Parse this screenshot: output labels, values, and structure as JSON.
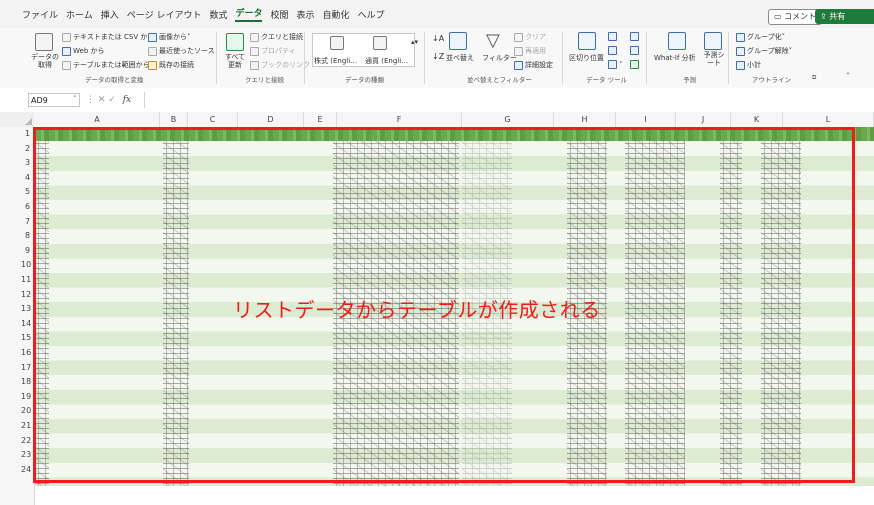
{
  "menu": {
    "tabs": [
      "ファイル",
      "ホーム",
      "挿入",
      "ページ レイアウト",
      "数式",
      "データ",
      "校閲",
      "表示",
      "自動化",
      "ヘルプ"
    ],
    "active_tab": "データ",
    "comment_label": "コメント",
    "share_label": "共有"
  },
  "ribbon": {
    "get_data": {
      "get_data_label": "データの取得",
      "from_text_csv": "テキストまたは CSV から",
      "from_web": "Web から",
      "from_table_range": "テーブルまたは範囲から",
      "from_picture": "画像から",
      "recent_sources": "最近使ったソース",
      "existing_connections": "既存の接続",
      "group_label": "データの取得と変換"
    },
    "queries": {
      "refresh_all": "すべて更新",
      "queries_connections": "クエリと接続",
      "properties": "プロパティ",
      "edit_links": "ブックのリンク",
      "group_label": "クエリと接続"
    },
    "data_types": {
      "stocks": "株式 (Engli…",
      "currencies": "通貨 (Engli…",
      "group_label": "データの種類"
    },
    "sort_filter": {
      "sort": "並べ替え",
      "filter": "フィルター",
      "clear": "クリア",
      "reapply": "再適用",
      "advanced": "詳細設定",
      "group_label": "並べ替えとフィルター"
    },
    "data_tools": {
      "text_to_columns": "区切り位置",
      "group_label": "データ ツール"
    },
    "forecast": {
      "what_if": "What-If 分析",
      "forecast_sheet": "予測シート",
      "group_label": "予測"
    },
    "outline": {
      "group": "グループ化",
      "ungroup": "グループ解除",
      "subtotal": "小計",
      "group_label": "アウトライン"
    }
  },
  "formula_bar": {
    "name_box": "AD9",
    "fx": "fx",
    "value": ""
  },
  "grid": {
    "columns": [
      "A",
      "B",
      "C",
      "D",
      "E",
      "F",
      "G",
      "H",
      "I",
      "J",
      "K",
      "L"
    ],
    "rows": [
      "1",
      "2",
      "3",
      "4",
      "5",
      "6",
      "7",
      "8",
      "9",
      "10",
      "11",
      "12",
      "13",
      "14",
      "15",
      "16",
      "17",
      "18",
      "19",
      "20",
      "21",
      "22",
      "23",
      "24"
    ]
  },
  "annotation": {
    "text": "リストデータからテーブルが作成される",
    "color": "#ee1c1c"
  },
  "colors": {
    "accent": "#1e7b3b",
    "table_header": "#6aa84f",
    "band_dark": "#dcebd1",
    "band_light": "#f3f8ee",
    "highlight": "#ee1c1c"
  }
}
